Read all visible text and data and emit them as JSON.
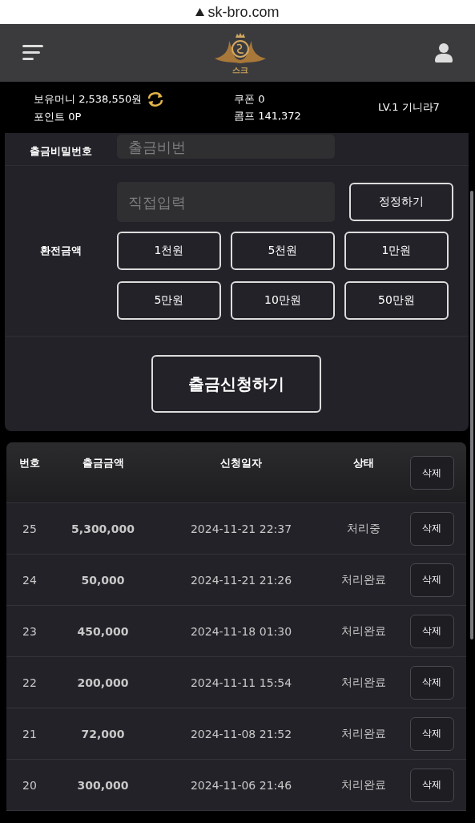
{
  "url_bar": {
    "domain": "sk-bro.com"
  },
  "header": {
    "logo_text": "스크"
  },
  "info_bar": {
    "money": "보유머니 2,538,550원",
    "points": "포인트 0P",
    "coupon": "쿠폰 0",
    "comp": "콤프 141,372",
    "level": "LV.1 기니라7"
  },
  "form": {
    "password_label": "출금비밀번호",
    "password_placeholder": "출금비번",
    "amount_label": "환전금액",
    "amount_placeholder": "직접입력",
    "reset_button": "정정하기",
    "amount_buttons": [
      "1천원",
      "5천원",
      "1만원",
      "5만원",
      "10만원",
      "50만원"
    ],
    "submit_button": "출금신청하기"
  },
  "table": {
    "columns": [
      "번호",
      "출금금액",
      "신청일자",
      "상태"
    ],
    "header_button": "삭제",
    "rows": [
      {
        "no": "25",
        "amount": "5,300,000",
        "date": "2024-11-21 22:37",
        "status": "처리중",
        "button": "삭제"
      },
      {
        "no": "24",
        "amount": "50,000",
        "date": "2024-11-21 21:26",
        "status": "처리완료",
        "button": "삭제"
      },
      {
        "no": "23",
        "amount": "450,000",
        "date": "2024-11-18 01:30",
        "status": "처리완료",
        "button": "삭제"
      },
      {
        "no": "22",
        "amount": "200,000",
        "date": "2024-11-11 15:54",
        "status": "처리완료",
        "button": "삭제"
      },
      {
        "no": "21",
        "amount": "72,000",
        "date": "2024-11-08 21:52",
        "status": "처리완료",
        "button": "삭제"
      },
      {
        "no": "20",
        "amount": "300,000",
        "date": "2024-11-06 21:46",
        "status": "처리완료",
        "button": "삭제"
      }
    ]
  }
}
